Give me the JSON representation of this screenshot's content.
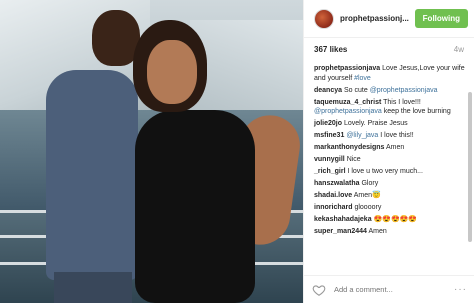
{
  "header": {
    "username": "prophetpassionj...",
    "follow_label": "Following",
    "follow_color": "#70c050"
  },
  "meta": {
    "likes": "367 likes",
    "time_ago": "4w"
  },
  "comments": [
    {
      "user": "prophetpassionjava",
      "text": "Love Jesus,Love your wife and yourself",
      "tail": "#love"
    },
    {
      "user": "deancya",
      "text": "So cute",
      "tail": "@prophetpassionjava"
    },
    {
      "user": "taquemuza_4_christ",
      "text": "This I love!!!",
      "tail": "@prophetpassionjava",
      "tail2": "keep the love burning"
    },
    {
      "user": "jolie20jo",
      "text": "Lovely. Praise Jesus"
    },
    {
      "user": "msfine31",
      "text": "I love this!!",
      "mention": "@lily_java"
    },
    {
      "user": "markanthonydesigns",
      "text": "Amen"
    },
    {
      "user": "vunnygill",
      "text": "Nice"
    },
    {
      "user": "_rich_girl",
      "text": "I love u two very much..."
    },
    {
      "user": "hanszwalatha",
      "text": "Glory"
    },
    {
      "user": "shadai.love",
      "text": "Amen😇"
    },
    {
      "user": "innorichard",
      "text": "gloooory"
    },
    {
      "user": "kekashahadajeka",
      "text": "😍😍😍😍😍"
    },
    {
      "user": "super_man2444",
      "text": "Amen"
    }
  ],
  "footer": {
    "comment_placeholder": "Add a comment...",
    "more_label": "···"
  },
  "icons": {
    "heart": "heart-icon",
    "more": "more-options-icon"
  }
}
